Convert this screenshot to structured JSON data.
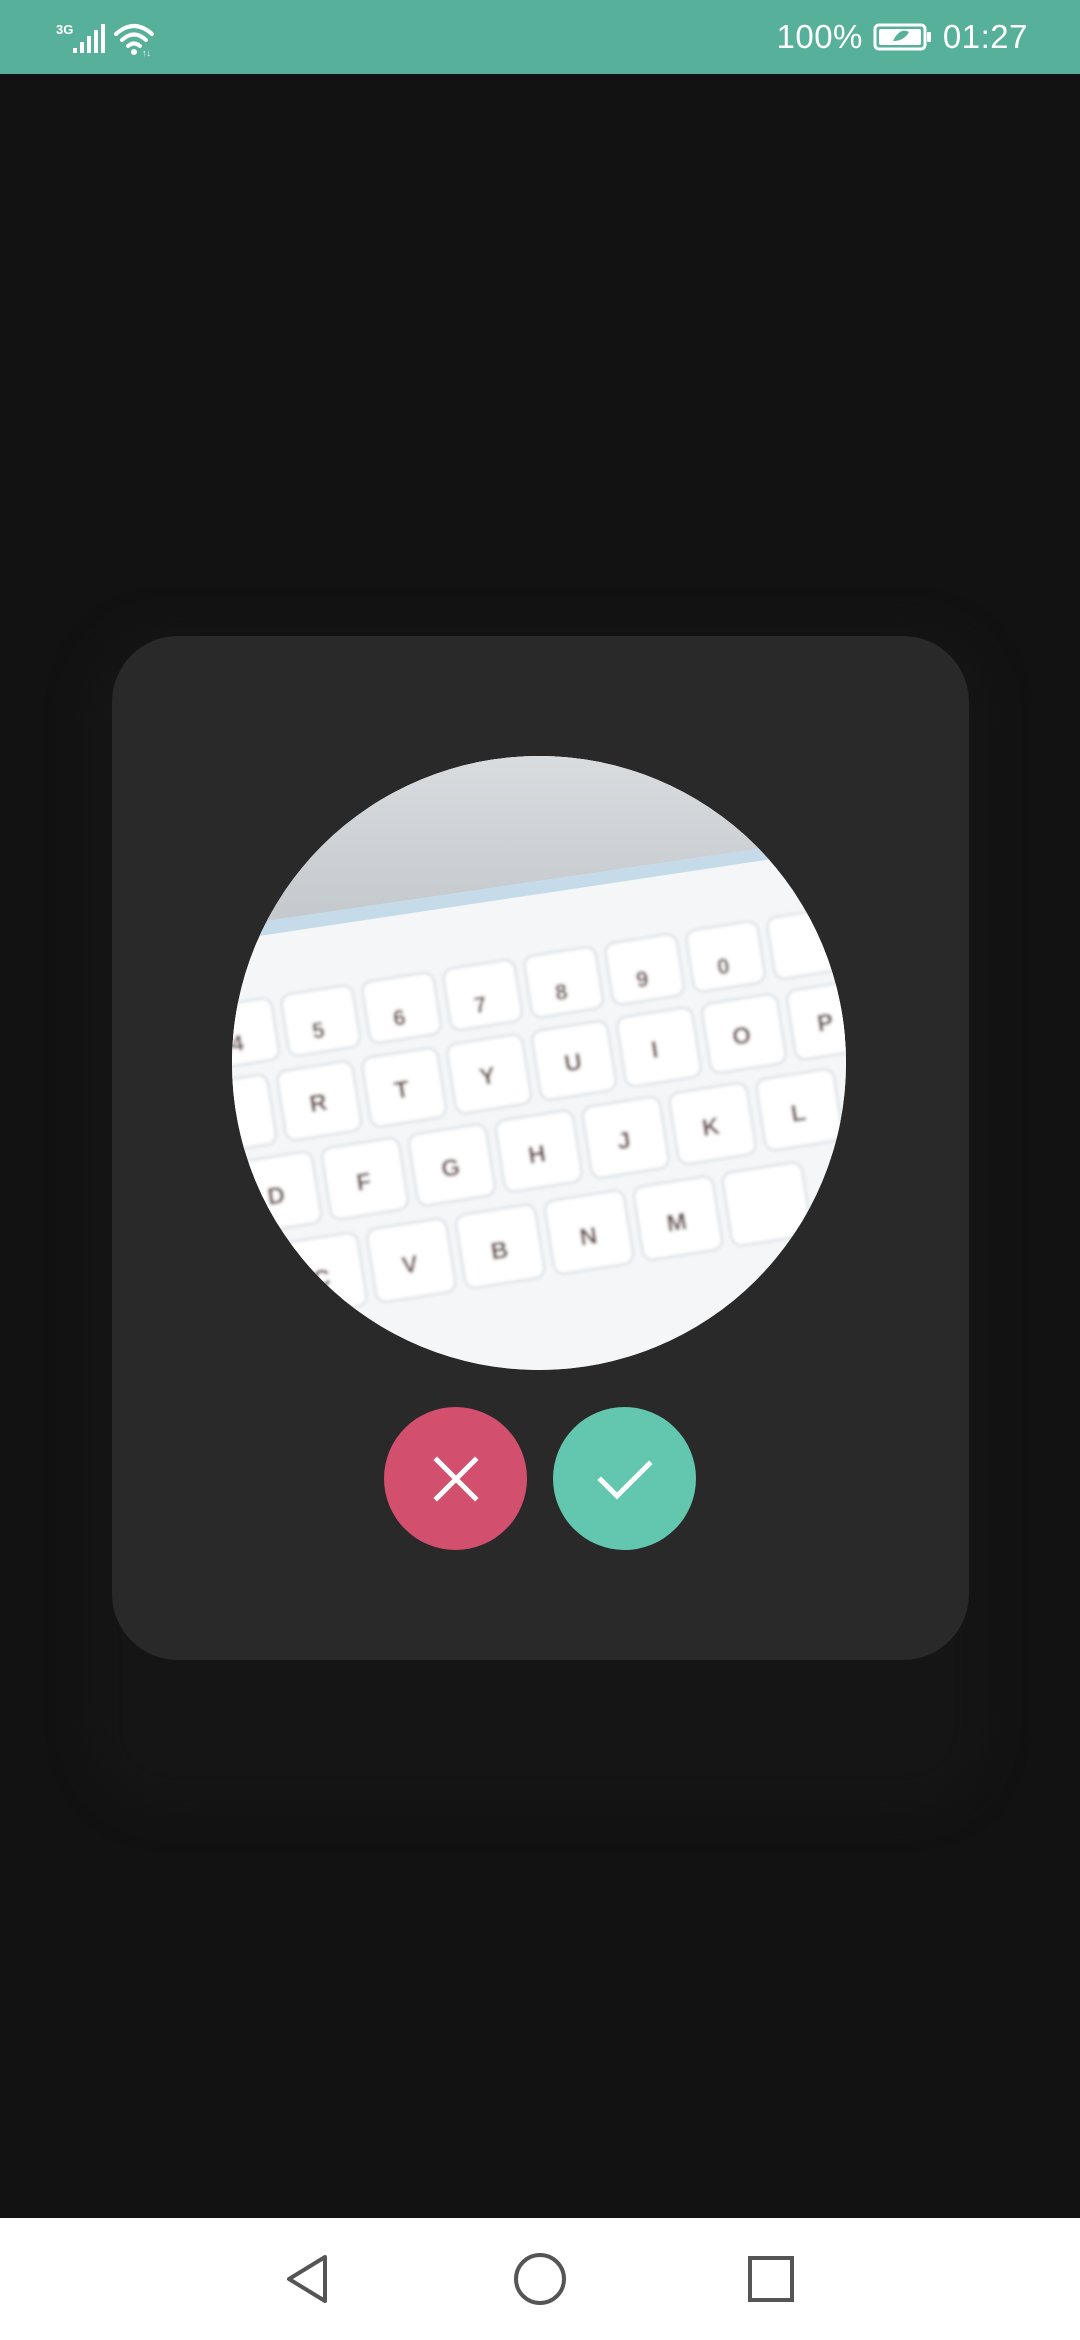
{
  "status_bar": {
    "network_label": "3G",
    "signal_icon": "cell-signal-icon",
    "wifi_icon": "wifi-icon",
    "battery_percent": "100%",
    "battery_icon": "battery-saver-icon",
    "time": "01:27",
    "background_color": "#57b09a"
  },
  "crop_dialog": {
    "preview_image": "keyboard-photo",
    "cancel_icon": "close-icon",
    "confirm_icon": "check-icon",
    "cancel_color": "#d2506e",
    "confirm_color": "#63c7b0"
  },
  "nav_bar": {
    "back_icon": "back-triangle-icon",
    "home_icon": "home-circle-icon",
    "recents_icon": "recents-square-icon"
  }
}
